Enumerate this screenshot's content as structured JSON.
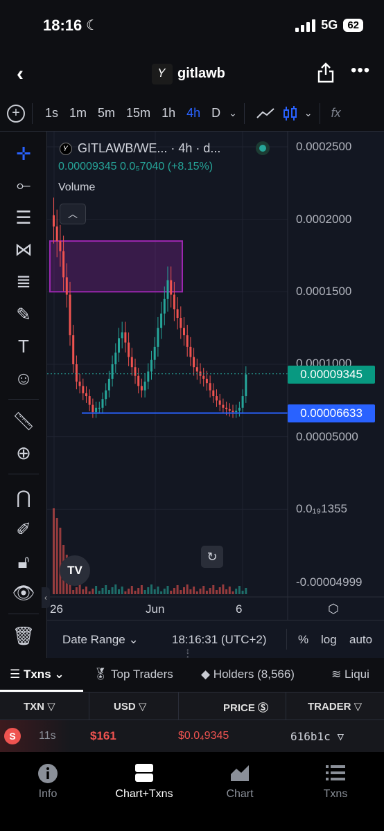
{
  "status_bar": {
    "time": "18:16",
    "network": "5G",
    "battery": "62"
  },
  "nav": {
    "title": "gitlawb"
  },
  "toolbar": {
    "intervals": [
      "1s",
      "1m",
      "5m",
      "15m",
      "1h",
      "4h",
      "D"
    ],
    "active_interval": "4h",
    "indicator_icon": "fx"
  },
  "chart": {
    "legend_title": "GITLAWB/WE...  · 4h · d...",
    "legend_values": "0.00009345  0.0₅7040 (+8.15%)",
    "volume_label": "Volume",
    "price_axis": [
      "0.0002500",
      "0.0002000",
      "0.0001500",
      "0.0001000",
      "0.00005000",
      "0.0₁₉1355",
      "-0.00004999"
    ],
    "time_axis": [
      "26",
      "Jun",
      "6"
    ],
    "last_price_tag": "0.00009345",
    "horizontal_line_tag": "0.00006633",
    "colors": {
      "up": "#26a69a",
      "down": "#ef5350",
      "line": "#2962ff",
      "zone": "#9c27b0"
    },
    "tv_logo": "TV"
  },
  "chart_data": {
    "type": "candlestick",
    "title": "GITLAWB/WE...",
    "interval": "4h",
    "x_ticks": [
      "26",
      "Jun",
      "6"
    ],
    "y_ticks": [
      0.00025,
      0.0002,
      0.00015,
      0.0001,
      5e-05,
      0
    ],
    "ylim": [
      -5e-05,
      0.00025
    ],
    "last_price": 9.345e-05,
    "change_pct": 8.15,
    "horizontal_line": 6.633e-05,
    "rectangle_zone": {
      "top": 0.000185,
      "bottom": 0.00015
    },
    "close_series": [
      0.000195,
      0.000185,
      0.000178,
      0.00016,
      0.000148,
      0.00012,
      0.0001,
      8.8e-05,
      8.5e-05,
      8e-05,
      7.8e-05,
      7.2e-05,
      6.7e-05,
      7e-05,
      7e-05,
      7.6e-05,
      8.2e-05,
      9e-05,
      0.0001,
      0.000108,
      0.000118,
      0.000122,
      0.000115,
      0.000105,
      9.8e-05,
      9.2e-05,
      8.5e-05,
      8.2e-05,
      8.8e-05,
      9.5e-05,
      0.000103,
      0.000112,
      0.000125,
      0.000135,
      0.000145,
      0.000158,
      0.000148,
      0.000138,
      0.000132,
      0.000125,
      0.00012,
      0.000112,
      0.000105,
      9.8e-05,
      9.5e-05,
      9.2e-05,
      9e-05,
      8.7e-05,
      8.2e-05,
      7.8e-05,
      7.5e-05,
      7.2e-05,
      7e-05,
      6.9e-05,
      6.8e-05,
      6.7e-05,
      6.8e-05,
      7e-05,
      7.8e-05,
      9.3e-05
    ],
    "volume_note": "volume bars shown at bottom of chart"
  },
  "date_range": {
    "label": "Date Range",
    "time": "18:16:31 (UTC+2)",
    "opt_percent": "%",
    "opt_log": "log",
    "opt_auto": "auto"
  },
  "tabs": [
    {
      "label": "Txns"
    },
    {
      "label": "Top Traders"
    },
    {
      "label": "Holders (8,566)"
    },
    {
      "label": "Liqui"
    }
  ],
  "table": {
    "headers": [
      "TXN",
      "USD",
      "PRICE",
      "TRADER"
    ],
    "rows": [
      {
        "type": "S",
        "age": "11s",
        "usd": "$161",
        "price": "$0.0₄9345",
        "trader": "616b1c"
      }
    ]
  },
  "bottom_nav": [
    {
      "label": "Info",
      "icon": "info-icon"
    },
    {
      "label": "Chart+Txns",
      "icon": "split-view-icon"
    },
    {
      "label": "Chart",
      "icon": "area-chart-icon"
    },
    {
      "label": "Txns",
      "icon": "list-icon"
    }
  ]
}
